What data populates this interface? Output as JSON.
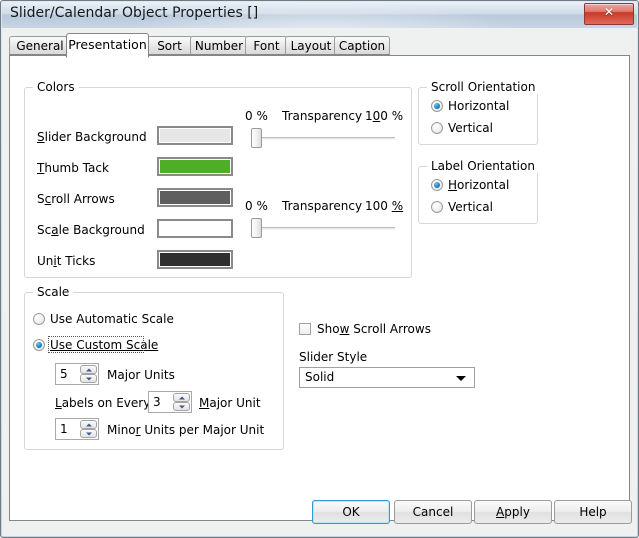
{
  "window": {
    "title": "Slider/Calendar Object Properties []",
    "close_label": "✕"
  },
  "tabs": [
    {
      "label": "General",
      "active": false
    },
    {
      "label": "Presentation",
      "active": true
    },
    {
      "label": "Sort",
      "active": false
    },
    {
      "label": "Number",
      "active": false
    },
    {
      "label": "Font",
      "active": false
    },
    {
      "label": "Layout",
      "active": false
    },
    {
      "label": "Caption",
      "active": false
    }
  ],
  "colors_group": {
    "legend": "Colors",
    "rows": [
      {
        "label": "Slider Background",
        "accel": "S",
        "color": "#e6e6e6"
      },
      {
        "label": "Thumb Tack",
        "accel": "T",
        "color": "#4fae26"
      },
      {
        "label": "Scroll Arrows",
        "accel": "c",
        "color": "#5e5e5e"
      },
      {
        "label": "Scale Background",
        "accel": "a",
        "color": "#ffffff"
      },
      {
        "label": "Unit Ticks",
        "accel": "i",
        "color": "#2f2f2f"
      }
    ],
    "sliders": [
      {
        "min_label": "0 %",
        "title": "Transparency",
        "max_label": "100 %",
        "value": 0
      },
      {
        "min_label": "0 %",
        "title": "Transparency",
        "max_label": "100 %",
        "value": 0
      }
    ]
  },
  "scroll_orientation": {
    "legend": "Scroll Orientation",
    "options": [
      {
        "label": "Horizontal",
        "selected": true
      },
      {
        "label": "Vertical",
        "selected": false
      }
    ]
  },
  "label_orientation": {
    "legend": "Label Orientation",
    "options": [
      {
        "label": "Horizontal",
        "selected": true
      },
      {
        "label": "Vertical",
        "selected": false
      }
    ]
  },
  "scale_group": {
    "legend": "Scale",
    "radios": [
      {
        "label": "Use Automatic Scale",
        "selected": false,
        "focused": false
      },
      {
        "label": "Use Custom Scale",
        "selected": true,
        "focused": true
      }
    ],
    "major_units": {
      "value": "5",
      "label": "Major Units"
    },
    "labels_every": {
      "prefix": "Labels on Every",
      "value": "3",
      "suffix": "Major Unit"
    },
    "minor_units": {
      "value": "1",
      "label": "Minor Units per Major Unit"
    }
  },
  "options": {
    "show_scroll_arrows": {
      "label": "Show Scroll Arrows",
      "checked": false
    },
    "slider_style": {
      "label": "Slider Style",
      "value": "Solid"
    }
  },
  "buttons": [
    {
      "label": "OK",
      "default": true
    },
    {
      "label": "Cancel",
      "default": false
    },
    {
      "label": "Apply",
      "default": false
    },
    {
      "label": "Help",
      "default": false
    }
  ]
}
